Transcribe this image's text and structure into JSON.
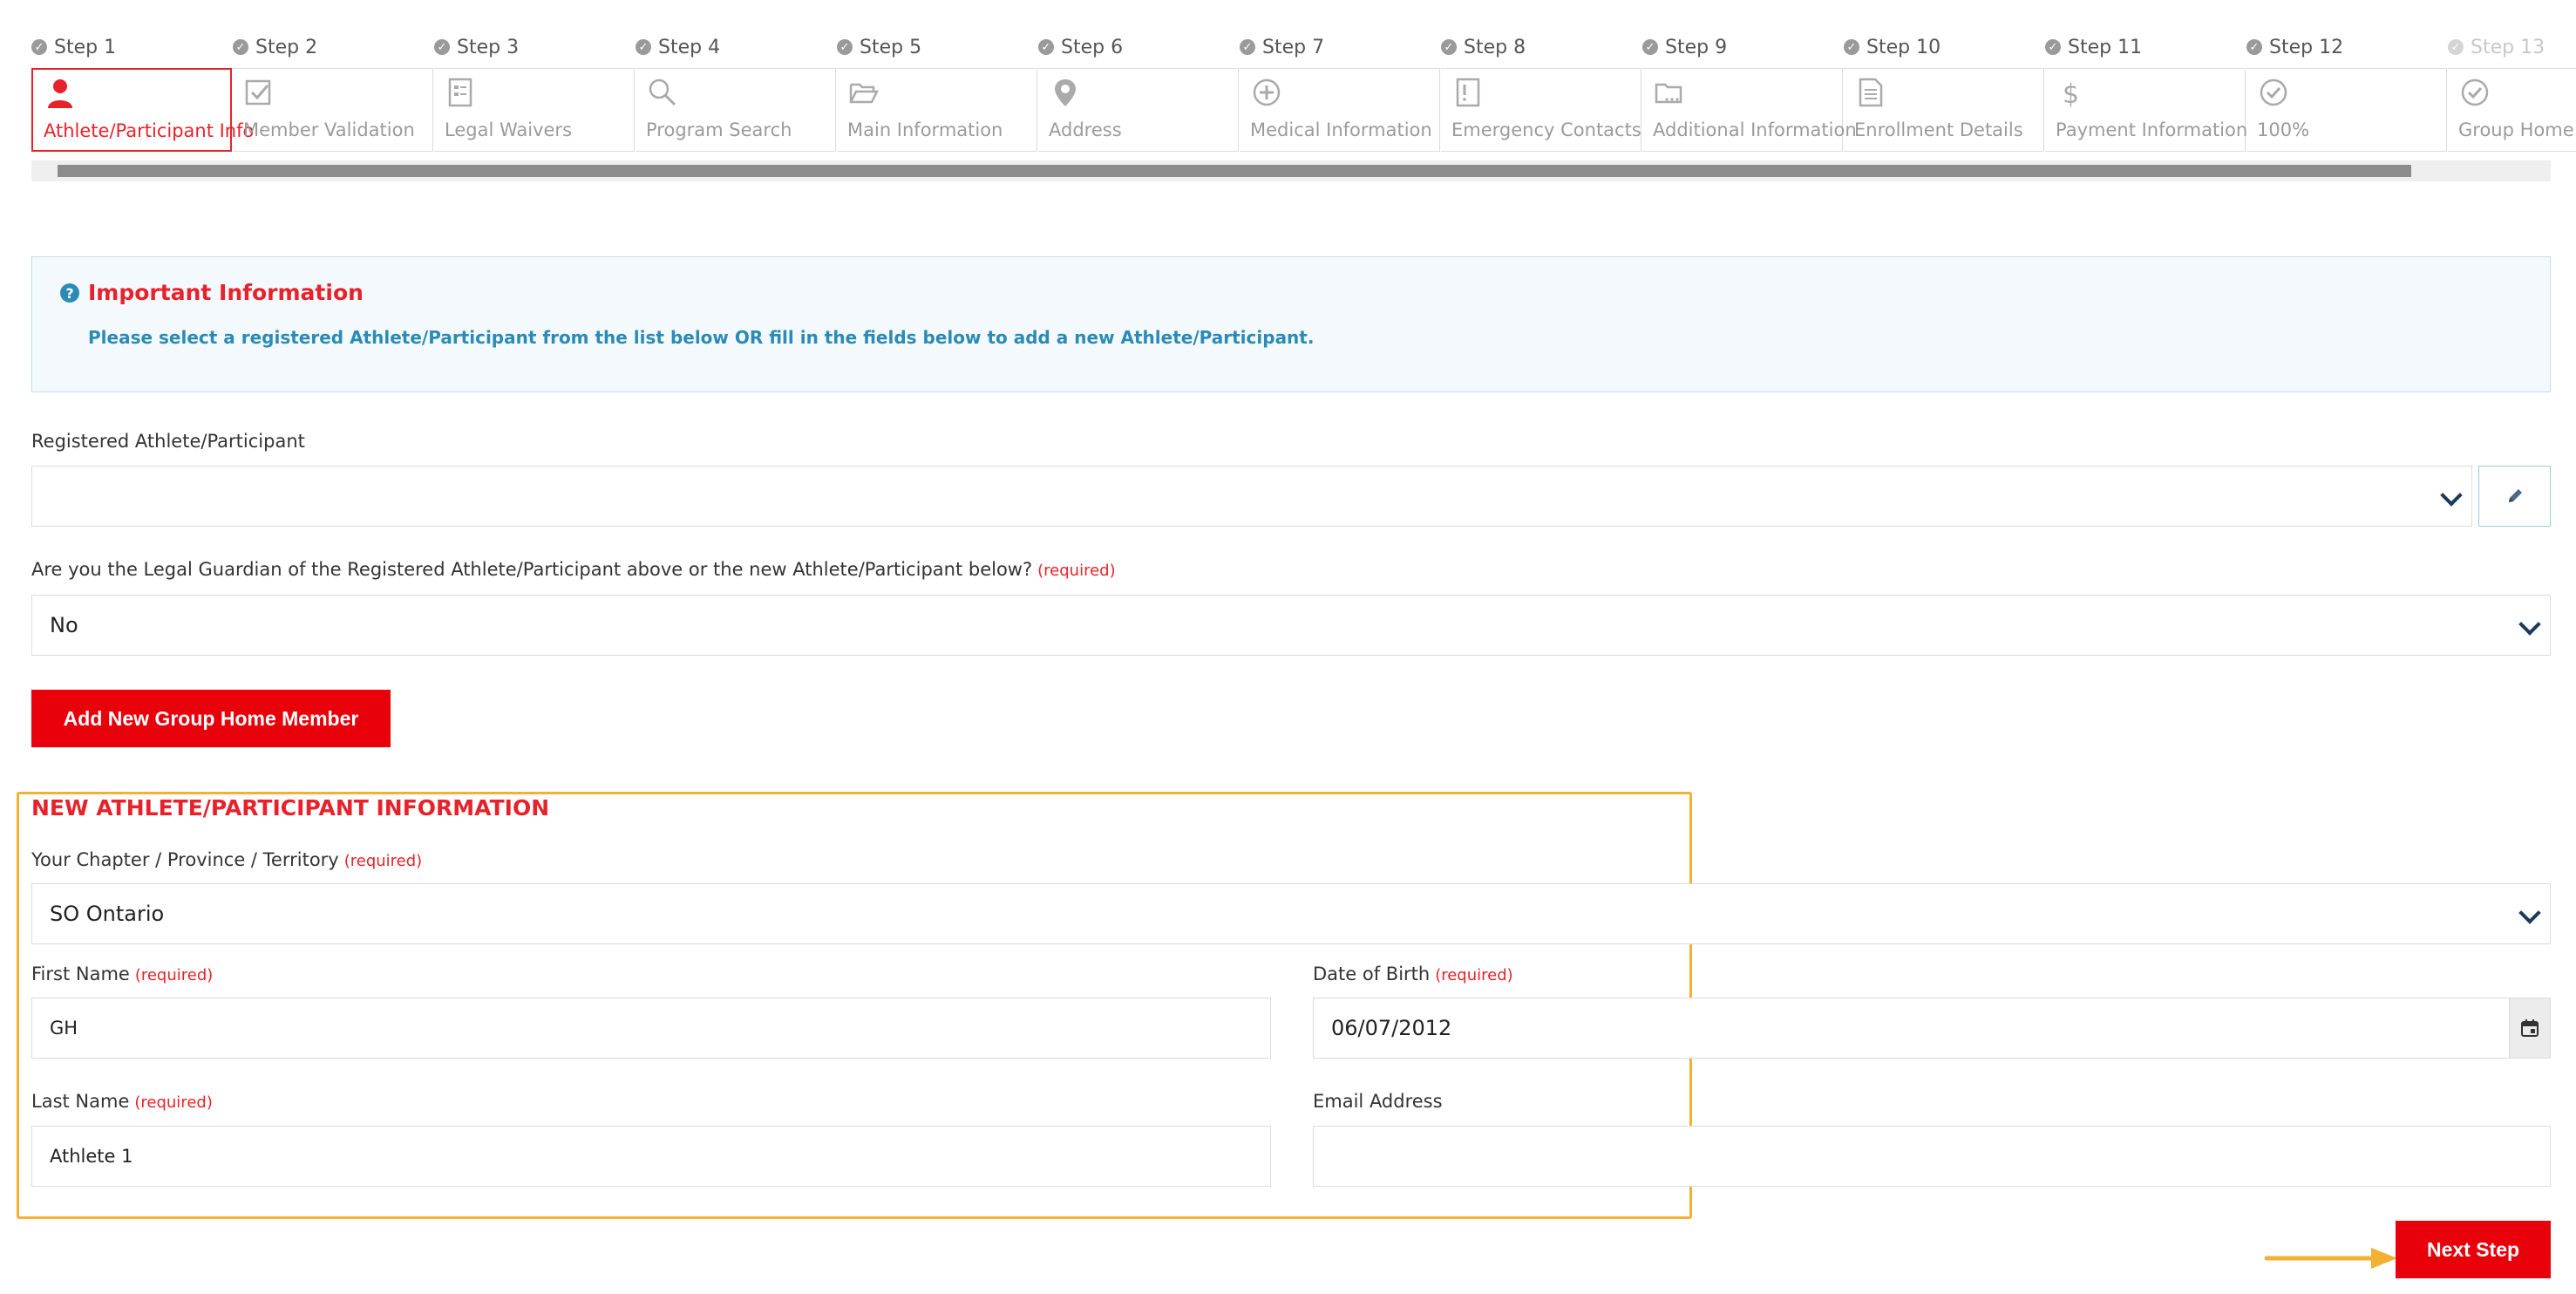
{
  "steps": [
    {
      "head": "Step 1",
      "label": "Athlete/Participant Info",
      "icon": "person-icon",
      "state": "active"
    },
    {
      "head": "Step 2",
      "label": "Member Validation",
      "icon": "checkbox-icon",
      "state": "normal"
    },
    {
      "head": "Step 3",
      "label": "Legal Waivers",
      "icon": "document-list-icon",
      "state": "normal"
    },
    {
      "head": "Step 4",
      "label": "Program Search",
      "icon": "search-icon",
      "state": "normal"
    },
    {
      "head": "Step 5",
      "label": "Main Information",
      "icon": "folder-open-icon",
      "state": "normal"
    },
    {
      "head": "Step 6",
      "label": "Address",
      "icon": "map-marker-icon",
      "state": "normal"
    },
    {
      "head": "Step 7",
      "label": "Medical Information",
      "icon": "plus-circle-icon",
      "state": "normal"
    },
    {
      "head": "Step 8",
      "label": "Emergency Contacts",
      "icon": "alert-document-icon",
      "state": "normal"
    },
    {
      "head": "Step 9",
      "label": "Additional Information",
      "icon": "folder-dots-icon",
      "state": "normal"
    },
    {
      "head": "Step 10",
      "label": "Enrollment Details",
      "icon": "document-icon",
      "state": "normal"
    },
    {
      "head": "Step 11",
      "label": "Payment Information",
      "icon": "dollar-icon",
      "state": "normal"
    },
    {
      "head": "Step 12",
      "label": "100%",
      "icon": "check-circle-icon",
      "state": "normal"
    },
    {
      "head": "Step 13",
      "label": "Group Home",
      "icon": "check-circle-icon",
      "state": "faded"
    }
  ],
  "info": {
    "title": "Important Information",
    "text": "Please select a registered Athlete/Participant from the list below OR fill in the fields below to add a new Athlete/Participant."
  },
  "registered": {
    "label": "Registered Athlete/Participant",
    "value": ""
  },
  "guardian": {
    "label": "Are you the Legal Guardian of the Registered Athlete/Participant above or the new Athlete/Participant below?",
    "required": "(required)",
    "value": "No"
  },
  "add_button": "Add New Group Home Member",
  "new_section": {
    "title": "NEW ATHLETE/PARTICIPANT INFORMATION",
    "chapter": {
      "label": "Your Chapter / Province / Territory",
      "required": "(required)",
      "value": "SO Ontario"
    },
    "first_name": {
      "label": "First Name",
      "required": "(required)",
      "value": "GH"
    },
    "dob": {
      "label": "Date of Birth",
      "required": "(required)",
      "value": "06/07/2012"
    },
    "last_name": {
      "label": "Last Name",
      "required": "(required)",
      "value": "Athlete 1"
    },
    "email": {
      "label": "Email Address",
      "value": ""
    }
  },
  "next_button": "Next Step",
  "colors": {
    "accent": "#e8000a",
    "info": "#2b8bb6",
    "highlight": "#f2b132"
  }
}
